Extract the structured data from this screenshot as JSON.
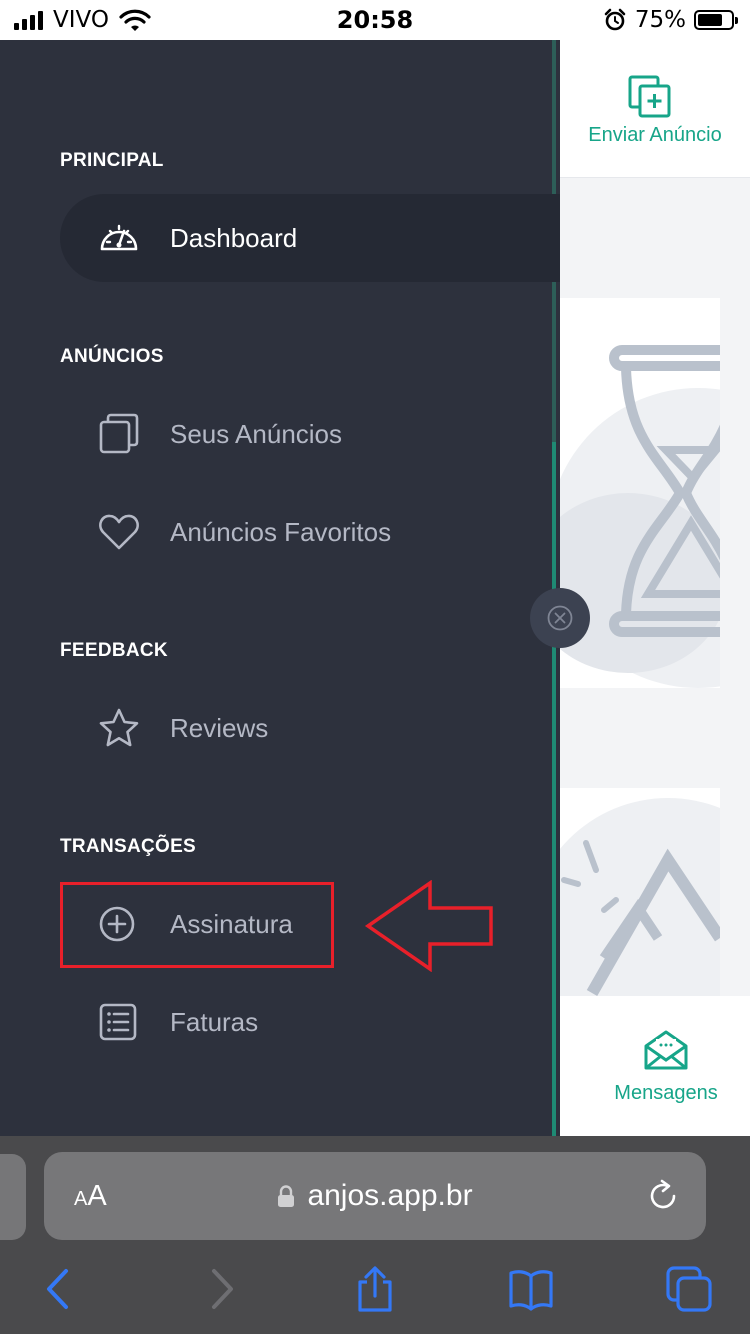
{
  "status_bar": {
    "carrier": "VIVO",
    "time": "20:58",
    "battery_percent": "75%",
    "battery_level": 0.75,
    "icons": [
      "signal-icon",
      "wifi-icon",
      "alarm-icon",
      "battery-icon"
    ]
  },
  "header": {
    "send_ad_label": "Enviar Anúncio",
    "send_ad_icon": "add-document-icon"
  },
  "bottom_nav": {
    "messages_label": "Mensagens",
    "messages_icon": "envelope-icon"
  },
  "sidebar": {
    "sections": [
      {
        "title": "PRINCIPAL",
        "items": [
          {
            "label": "Dashboard",
            "icon": "speedometer-icon",
            "active": true
          }
        ]
      },
      {
        "title": "ANÚNCIOS",
        "items": [
          {
            "label": "Seus Anúncios",
            "icon": "copy-icon"
          },
          {
            "label": "Anúncios Favoritos",
            "icon": "heart-icon"
          }
        ]
      },
      {
        "title": "FEEDBACK",
        "items": [
          {
            "label": "Reviews",
            "icon": "star-icon"
          }
        ]
      },
      {
        "title": "TRANSAÇÕES",
        "items": [
          {
            "label": "Assinatura",
            "icon": "plus-circle-icon",
            "highlighted": true
          },
          {
            "label": "Faturas",
            "icon": "list-icon"
          }
        ]
      }
    ],
    "close_icon": "close-circle-icon"
  },
  "annotation": {
    "color": "#e8202a",
    "arrow_icon": "left-arrow-outline-icon"
  },
  "browser": {
    "text_size_small": "A",
    "text_size_large": "A",
    "url": "anjos.app.br",
    "icons": [
      "lock-icon",
      "reload-icon",
      "back-icon",
      "forward-icon",
      "share-icon",
      "bookmarks-icon",
      "tabs-icon"
    ]
  },
  "colors": {
    "accent": "#17a589",
    "sidebar_bg": "#2d313d",
    "ios_blue": "#3478f6"
  }
}
